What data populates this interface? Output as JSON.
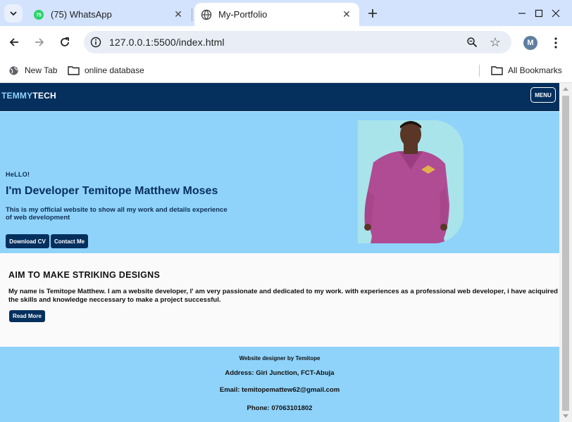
{
  "browser": {
    "tabs": [
      {
        "title": "(75) WhatsApp",
        "badge": "75",
        "active": false
      },
      {
        "title": "My-Portfolio",
        "active": true
      }
    ],
    "url": "127.0.0.1:5500/index.html",
    "profile_initial": "M",
    "bookmarks": [
      {
        "label": "New Tab",
        "icon": "globe-icon"
      },
      {
        "label": "online database",
        "icon": "folder-icon"
      }
    ],
    "all_bookmarks_label": "All Bookmarks"
  },
  "site": {
    "logo_part1": "TEMMY",
    "logo_part2": "TECH",
    "menu_label": "MENU",
    "hero": {
      "greeting": "HeLLO!",
      "title": "I'm Developer Temitope Matthew Moses",
      "description": "This is my official website to show all my work and details experience of web development",
      "download_label": "Download CV",
      "contact_label": "Contact Me"
    },
    "about": {
      "title": "AIM TO MAKE STRIKING DESIGNS",
      "text": "My name is Temitope Matthew. I am a website developer, I' am very passionate and dedicated to my work. with experiences as a professional web developer, i have aciquired the skills and knowledge neccessary to make a project successful.",
      "read_more_label": "Read More"
    },
    "footer": {
      "credit": "Website designer by Temitope",
      "address": "Address: Giri Junction, FCT-Abuja",
      "email": "Email: temitopemattew62@gmail.com",
      "phone": "Phone: 07063101802"
    }
  },
  "colors": {
    "navy": "#05305e",
    "sky": "#8fd3fb",
    "logo_accent": "#90d2fa"
  }
}
